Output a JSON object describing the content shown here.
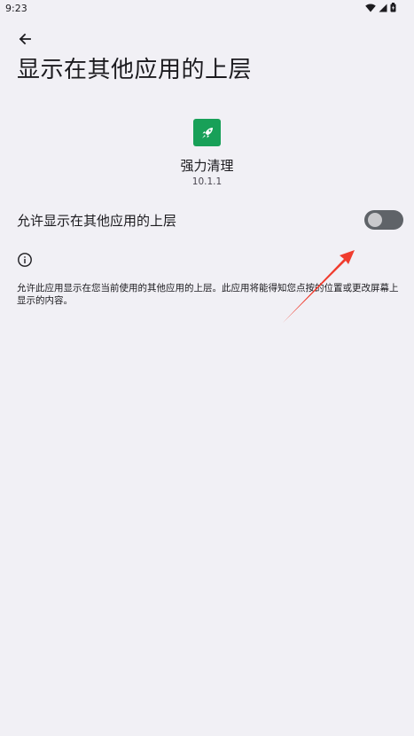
{
  "status_bar": {
    "time": "9:23",
    "icons": [
      "wifi-icon",
      "cellular-signal-icon",
      "battery-icon"
    ]
  },
  "header": {
    "back_icon": "arrow-left-icon",
    "title": "显示在其他应用的上层"
  },
  "app": {
    "icon": "rocket-icon",
    "icon_color": "#18a058",
    "name": "强力清理",
    "version": "10.1.1"
  },
  "permission": {
    "label": "允许显示在其他应用的上层",
    "enabled": false
  },
  "info": {
    "icon": "info-icon",
    "description": "允许此应用显示在您当前使用的其他应用的上层。此应用将能得知您点按的位置或更改屏幕上显示的内容。"
  },
  "annotation": {
    "arrow_color": "#f03c2e"
  }
}
